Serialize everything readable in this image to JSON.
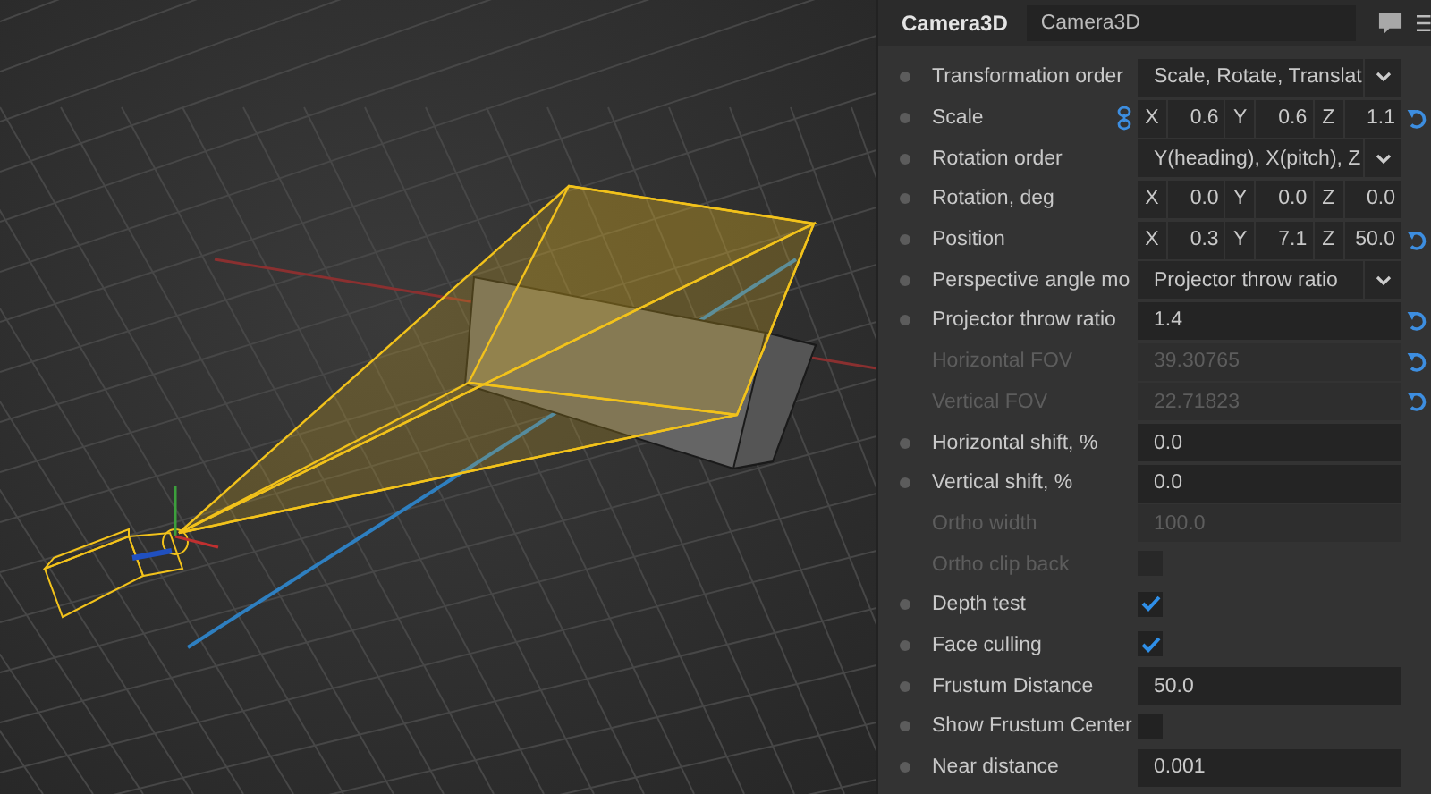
{
  "header": {
    "title": "Camera3D",
    "name_field": "Camera3D"
  },
  "rows": [
    {
      "kind": "dropdown",
      "label": "Transformation order",
      "disabled": false,
      "value": "Scale, Rotate, Translat",
      "reset": false
    },
    {
      "kind": "xyz",
      "label": "Scale",
      "disabled": false,
      "linked": true,
      "values": [
        {
          "axis": "X",
          "value": "0.6"
        },
        {
          "axis": "Y",
          "value": "0.6"
        },
        {
          "axis": "Z",
          "value": "1.1"
        }
      ],
      "reset": true
    },
    {
      "kind": "dropdown",
      "label": "Rotation order",
      "disabled": false,
      "value": "Y(heading), X(pitch), Z",
      "reset": false
    },
    {
      "kind": "xyz",
      "label": "Rotation, deg",
      "disabled": false,
      "linked": false,
      "values": [
        {
          "axis": "X",
          "value": "0.0"
        },
        {
          "axis": "Y",
          "value": "0.0"
        },
        {
          "axis": "Z",
          "value": "0.0"
        }
      ],
      "reset": false
    },
    {
      "kind": "xyz",
      "label": "Position",
      "disabled": false,
      "linked": false,
      "values": [
        {
          "axis": "X",
          "value": "0.3"
        },
        {
          "axis": "Y",
          "value": "7.1"
        },
        {
          "axis": "Z",
          "value": "50.0"
        }
      ],
      "reset": true
    },
    {
      "kind": "dropdown",
      "label": "Perspective angle mo",
      "disabled": false,
      "value": "Projector throw ratio",
      "reset": false
    },
    {
      "kind": "field",
      "label": "Projector throw ratio",
      "disabled": false,
      "value": "1.4",
      "reset": true
    },
    {
      "kind": "field",
      "label": "Horizontal FOV",
      "disabled": true,
      "value": "39.30765",
      "reset": true
    },
    {
      "kind": "field",
      "label": "Vertical FOV",
      "disabled": true,
      "value": "22.71823",
      "reset": true
    },
    {
      "kind": "field",
      "label": "Horizontal shift, %",
      "disabled": false,
      "value": "0.0",
      "reset": false
    },
    {
      "kind": "field",
      "label": "Vertical shift, %",
      "disabled": false,
      "value": "0.0",
      "reset": false
    },
    {
      "kind": "field",
      "label": "Ortho width",
      "disabled": true,
      "value": "100.0",
      "reset": false
    },
    {
      "kind": "checkbox",
      "label": "Ortho clip back",
      "disabled": true,
      "checked": false,
      "reset": false
    },
    {
      "kind": "checkbox",
      "label": "Depth test",
      "disabled": false,
      "checked": true,
      "reset": false
    },
    {
      "kind": "checkbox",
      "label": "Face culling",
      "disabled": false,
      "checked": true,
      "reset": false
    },
    {
      "kind": "field",
      "label": "Frustum Distance",
      "disabled": false,
      "value": "50.0",
      "reset": false
    },
    {
      "kind": "checkbox",
      "label": "Show Frustum Center",
      "disabled": false,
      "checked": false,
      "reset": false
    },
    {
      "kind": "field",
      "label": "Near distance",
      "disabled": false,
      "value": "0.001",
      "reset": false
    }
  ]
}
